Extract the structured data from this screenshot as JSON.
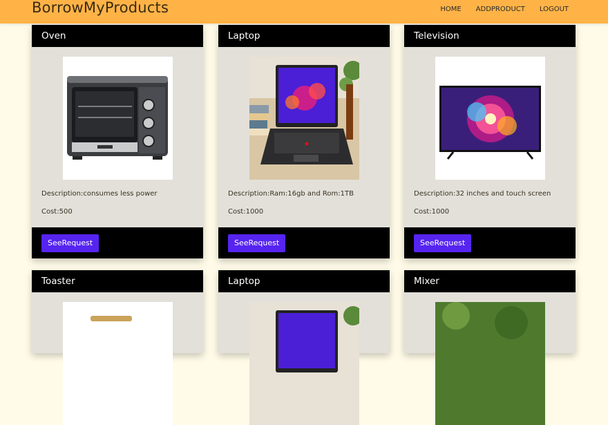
{
  "brand": "BorrowMyProducts",
  "nav": [
    {
      "label": "HOME"
    },
    {
      "label": "ADDPRODUCT"
    },
    {
      "label": "LOGOUT"
    }
  ],
  "products": [
    {
      "name": "Oven",
      "description": "Description:consumes less power",
      "cost": "Cost:500",
      "button": "SeeRequest"
    },
    {
      "name": "Laptop",
      "description": "Description:Ram:16gb and Rom:1TB",
      "cost": "Cost:1000",
      "button": "SeeRequest"
    },
    {
      "name": "Television",
      "description": "Description:32 inches and touch screen",
      "cost": "Cost:1000",
      "button": "SeeRequest"
    },
    {
      "name": "Toaster"
    },
    {
      "name": "Laptop"
    },
    {
      "name": "Mixer"
    }
  ],
  "colors": {
    "navbar": "#ffb347",
    "page_background": "#fffbe8",
    "card_background": "#e2e0d9",
    "card_header": "#000000",
    "button": "#5624f0"
  }
}
